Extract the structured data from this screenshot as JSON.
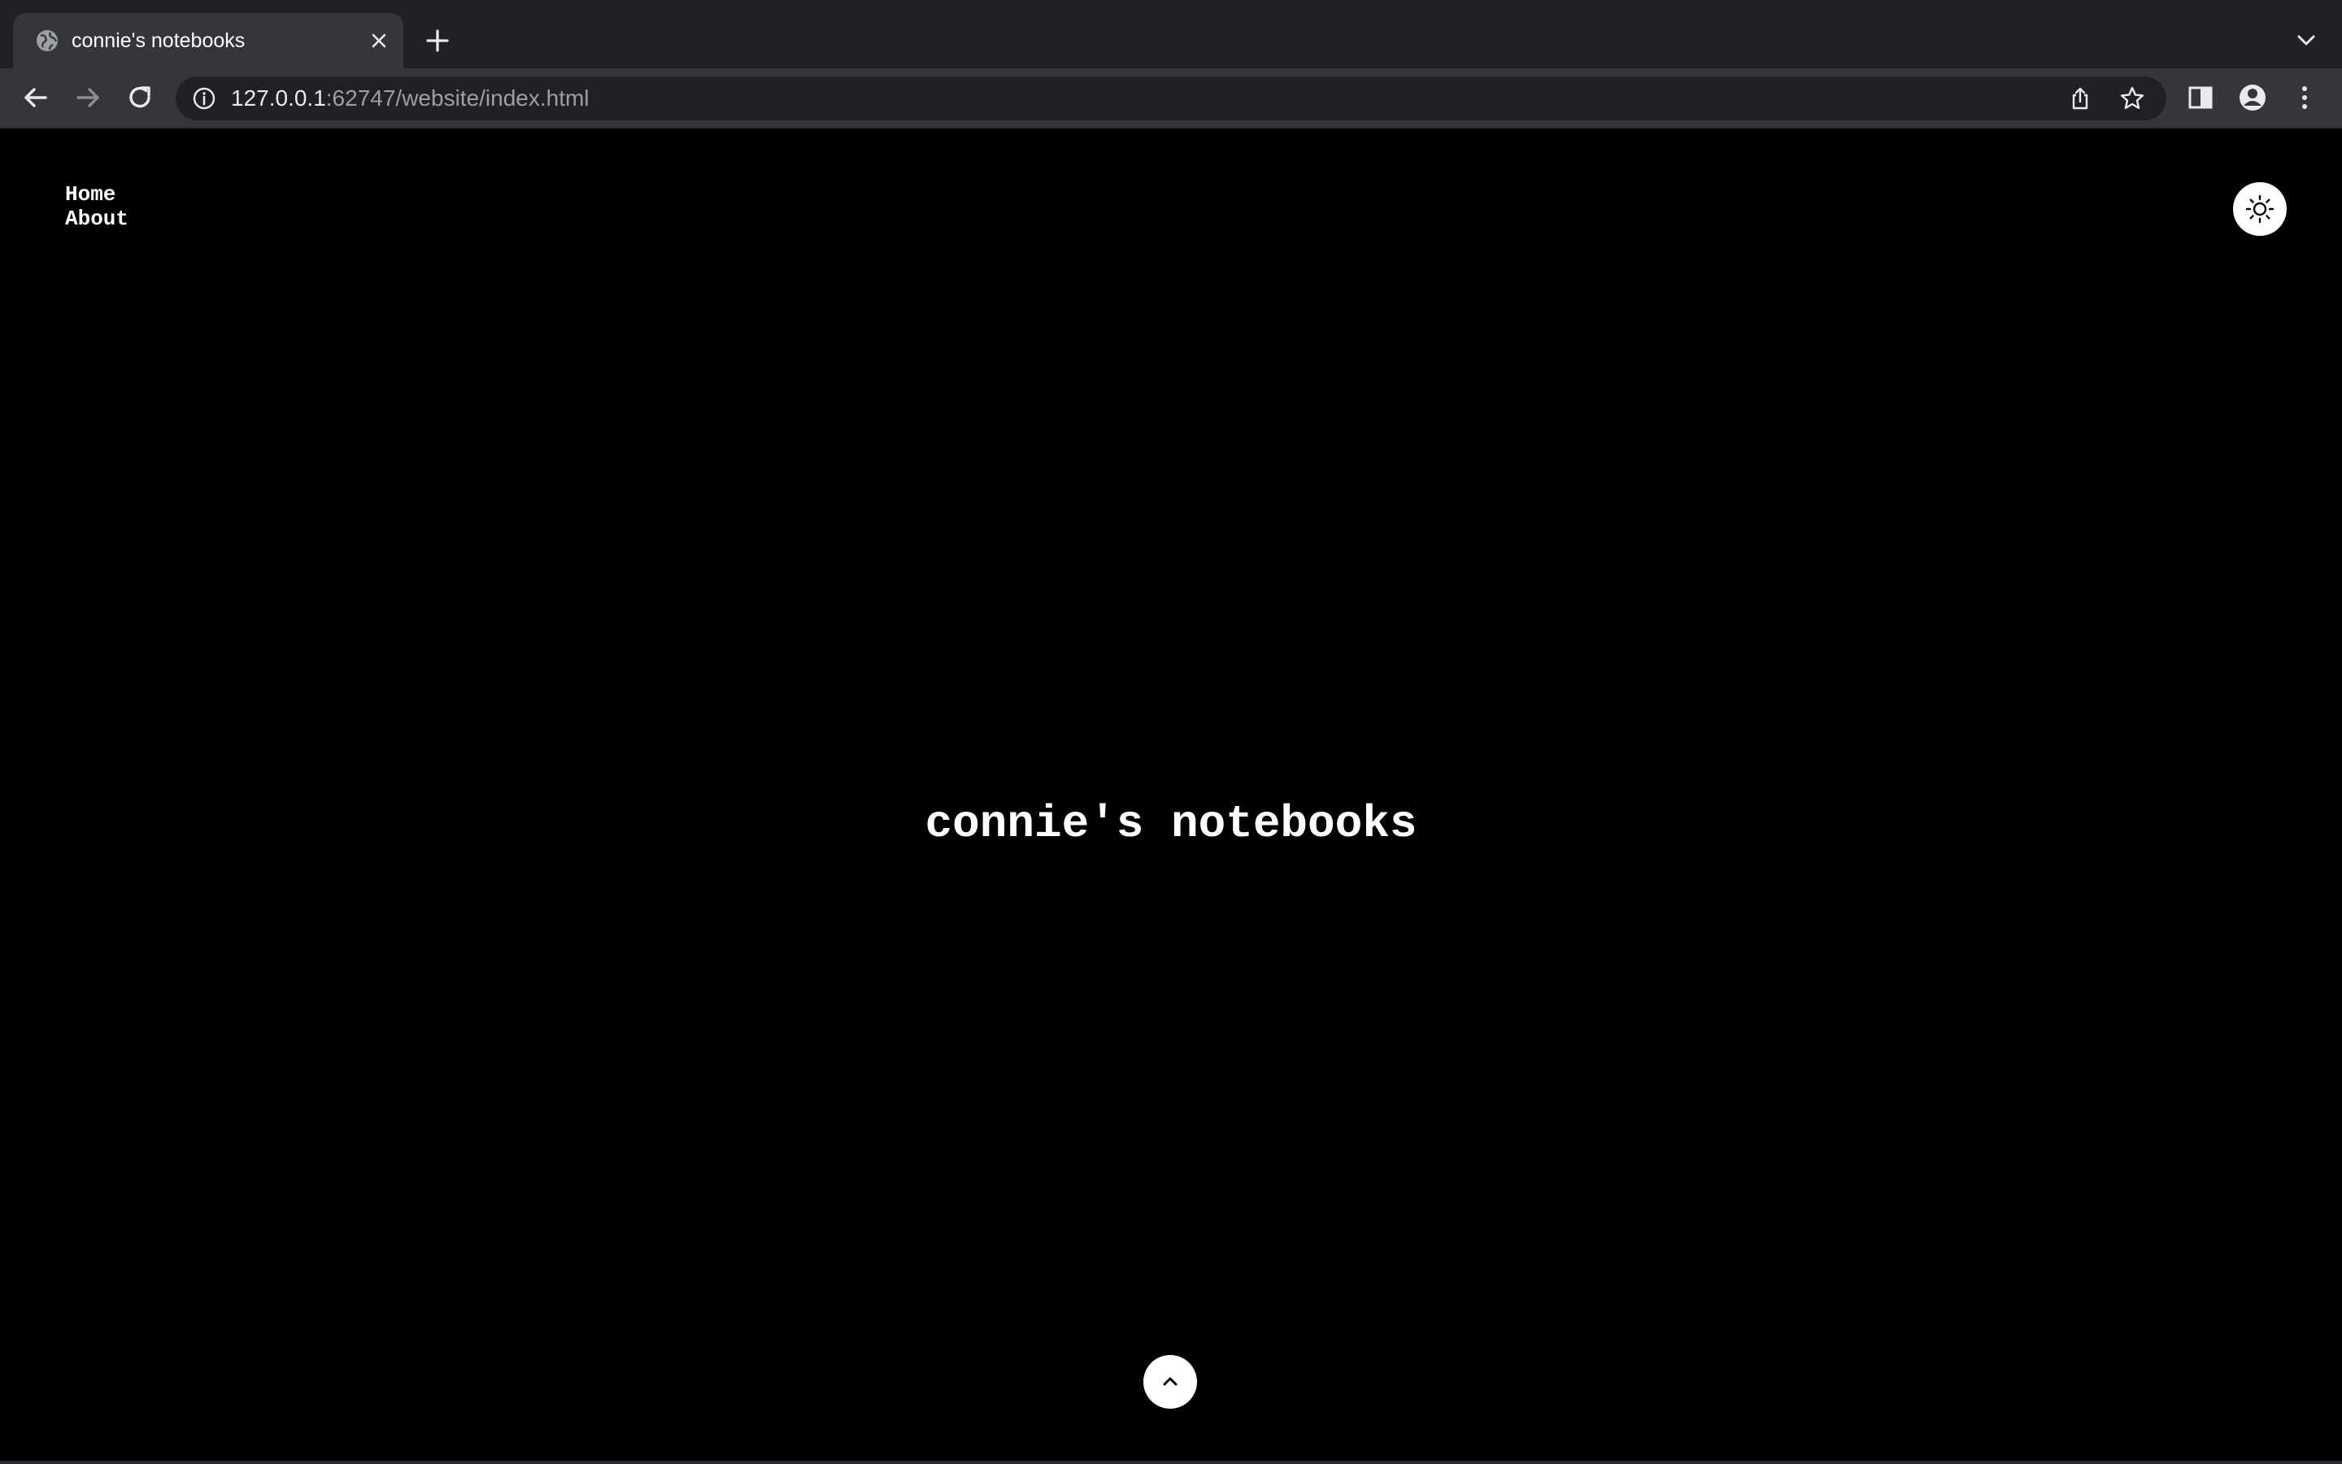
{
  "browser": {
    "tab": {
      "title": "connie's notebooks",
      "favicon": "globe-icon"
    },
    "address": {
      "host": "127.0.0.1",
      "rest": ":62747/website/index.html"
    },
    "icons": {
      "back": "arrow-left-icon",
      "forward": "arrow-right-icon",
      "reload": "reload-icon",
      "info": "info-icon",
      "share": "share-icon",
      "bookmark": "star-icon",
      "side_panel": "side-panel-icon",
      "profile": "profile-icon",
      "menu": "kebab-menu-icon",
      "tab_search": "chevron-down-icon",
      "new_tab": "plus-icon",
      "close_tab": "close-icon"
    },
    "colors": {
      "tabstrip": "#202124",
      "toolbar": "#35363a",
      "omnibox": "#202124"
    }
  },
  "page": {
    "nav": {
      "home": "Home",
      "about": "About"
    },
    "title": "connie's notebooks",
    "theme_toggle_icon": "sun-icon",
    "scroll_top_icon": "chevron-up-icon",
    "colors": {
      "background": "#000000",
      "text": "#ffffff",
      "buttons": "#ffffff"
    }
  }
}
